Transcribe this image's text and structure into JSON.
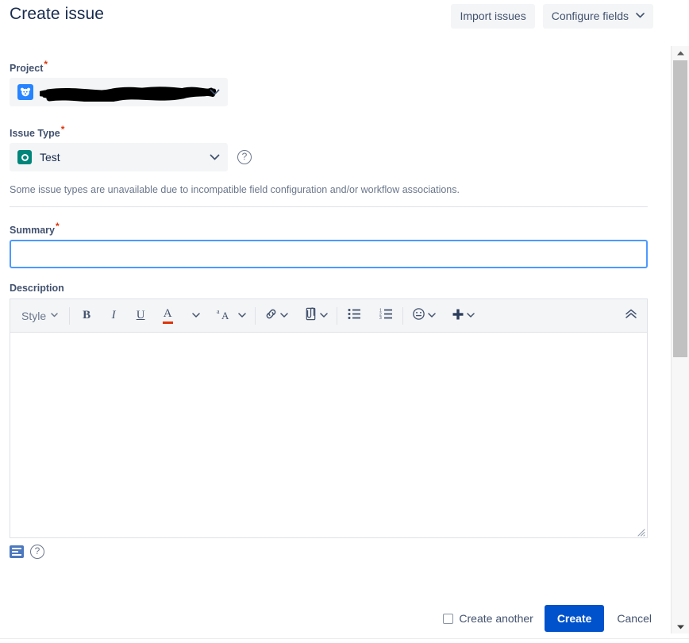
{
  "header": {
    "title": "Create issue",
    "import_issues_label": "Import issues",
    "configure_fields_label": "Configure fields",
    "chevron_icon": "chevron-down-icon"
  },
  "form": {
    "project": {
      "label": "Project",
      "required_marker": "*",
      "value": "",
      "redacted": true,
      "avatar_icon": "project-avatar-icon",
      "chevron_icon": "chevron-down-icon"
    },
    "issue_type": {
      "label": "Issue Type",
      "required_marker": "*",
      "value": "Test",
      "type_icon": "test-issue-type-icon",
      "chevron_icon": "chevron-down-icon",
      "help_icon": "help-circle-icon",
      "hint": "Some issue types are unavailable due to incompatible field configuration and/or workflow associations."
    },
    "summary": {
      "label": "Summary",
      "required_marker": "*",
      "value": "",
      "placeholder": ""
    },
    "description": {
      "label": "Description",
      "value": "",
      "toolbar": {
        "style_label": "Style",
        "bold_label": "B",
        "italic_label": "I",
        "underline_label": "U",
        "text_color_label": "A",
        "text_color_swatch": "#de350b",
        "more_formatting_label": "aA",
        "link_icon": "link-icon",
        "attachment_icon": "attachment-icon",
        "bullet_list_icon": "bullet-list-icon",
        "numbered_list_icon": "numbered-list-icon",
        "emoji_icon": "emoji-icon",
        "insert_more_icon": "plus-icon",
        "collapse_icon": "chevron-double-up-icon",
        "dropdown_icon": "chevron-down-icon"
      },
      "footer": {
        "mode_toggle_icon": "visual-text-mode-icon",
        "help_icon": "help-circle-icon"
      },
      "resize_icon": "resize-grip-icon"
    }
  },
  "footer": {
    "create_another_label": "Create another",
    "create_another_checked": false,
    "create_label": "Create",
    "cancel_label": "Cancel"
  },
  "scrollbar": {
    "up_icon": "scroll-up-arrow-icon",
    "down_icon": "scroll-down-arrow-icon",
    "thumb": "scrollbar-thumb"
  },
  "colors": {
    "primary": "#0052cc",
    "focus_border": "#4c9aff",
    "required": "#de350b",
    "subtle_bg": "#f4f5f7",
    "issue_type_icon": "#00857a",
    "project_avatar": "#2684ff"
  }
}
